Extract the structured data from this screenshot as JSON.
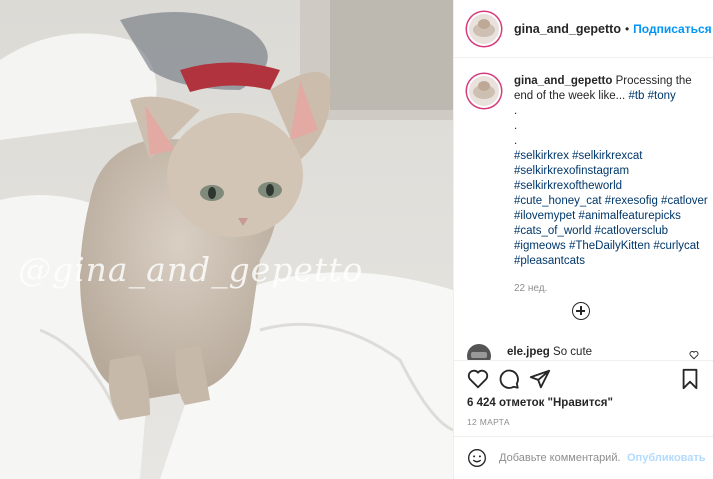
{
  "post": {
    "watermark": "@gina_and_gepetto",
    "author": {
      "username": "gina_and_gepetto",
      "separator": "•",
      "follow_label": "Подписаться"
    },
    "caption": {
      "username": "gina_and_gepetto",
      "text": "Processing the end of the week like...",
      "inline_tags": [
        "#tb",
        "#tony"
      ],
      "dots": [
        ".",
        ".",
        "."
      ],
      "hashtag_lines": [
        "#selkirkrex #selkirkrexcat",
        "#selkirkrexofinstagram",
        "#selkirkrexoftheworld",
        "#cute_honey_cat #rexesofig #catlover",
        "#ilovemypet #animalfeaturepicks",
        "#cats_of_world #catloversclub",
        "#igmeows #TheDailyKitten #curlycat",
        "#pleasantcats"
      ],
      "time": "22 нед."
    },
    "comment": {
      "username": "ele.jpeg",
      "text": "So cute"
    },
    "likes": "6 424 отметок \"Нравится\"",
    "date": "12 МАРТА",
    "add_comment": {
      "placeholder": "Добавьте комментарий...",
      "publish_label": "Опубликовать"
    },
    "icons": [
      "heart-icon",
      "comment-icon",
      "share-icon",
      "bookmark-icon",
      "smile-icon",
      "plus-circle-icon"
    ],
    "colors": {
      "accent": "#0095f6",
      "tag": "#00376b",
      "muted": "#8e8e8e"
    }
  }
}
